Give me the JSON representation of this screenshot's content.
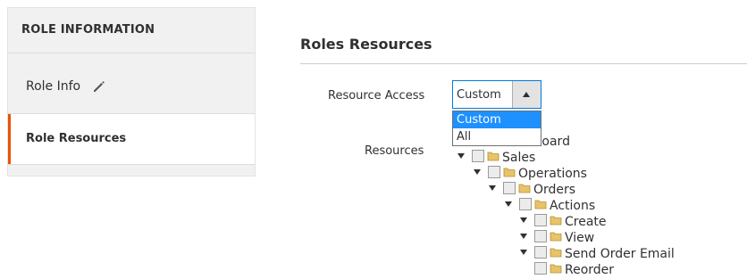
{
  "sidebar": {
    "title": "ROLE INFORMATION",
    "items": [
      {
        "label": "Role Info"
      },
      {
        "label": "Role Resources",
        "active": true
      }
    ]
  },
  "main": {
    "section_title": "Roles Resources",
    "resource_access": {
      "label": "Resource Access",
      "selected": "Custom",
      "options": [
        "Custom",
        "All"
      ]
    },
    "resources": {
      "label": "Resources",
      "tree": [
        {
          "label": "Dashboard",
          "level": 2
        },
        {
          "label": "Sales",
          "level": 2
        },
        {
          "label": "Operations",
          "level": 3
        },
        {
          "label": "Orders",
          "level": 4
        },
        {
          "label": "Actions",
          "level": 5
        },
        {
          "label": "Create",
          "level": 6
        },
        {
          "label": "View",
          "level": 6
        },
        {
          "label": "Send Order Email",
          "level": 6
        },
        {
          "label": "Reorder",
          "level": 6
        }
      ]
    }
  },
  "colors": {
    "accent": "#eb5202",
    "select_border": "#007bdb",
    "option_highlight": "#1e90ff"
  }
}
